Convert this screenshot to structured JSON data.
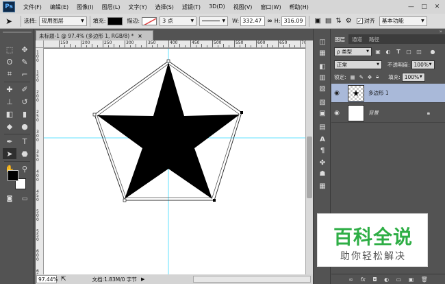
{
  "app": {
    "logo": "Ps"
  },
  "menu": [
    "文件(F)",
    "编辑(E)",
    "图像(I)",
    "图层(L)",
    "文字(Y)",
    "选择(S)",
    "滤镜(T)",
    "3D(D)",
    "视图(V)",
    "窗口(W)",
    "帮助(H)"
  ],
  "window_controls": {
    "minimize": "—",
    "restore": "□",
    "close": "✕"
  },
  "options": {
    "select_label": "选择:",
    "select_value": "现用图层",
    "fill_label": "填充:",
    "stroke_label": "描边:",
    "stroke_size": "3 点",
    "w_label": "W:",
    "w_value": "332.47",
    "link_icon": "link-icon",
    "h_label": "H:",
    "h_value": "316.09",
    "align_label": "对齐",
    "workspace": "基本功能",
    "fill_color": "#000000",
    "stroke_color": "#e04040"
  },
  "document": {
    "tab_title": "未标题-1 @ 97.4% (多边形 1, RGB/8) *",
    "close": "×",
    "ruler_h": [
      "150",
      "200",
      "250",
      "300",
      "350",
      "400",
      "450",
      "500",
      "550",
      "600",
      "650",
      "700"
    ],
    "ruler_v": [
      "1 0 0",
      "1 5 0",
      "2 0 0",
      "2 5 0",
      "3 0 0",
      "3 5 0",
      "4 0 0",
      "4 5 0",
      "5 0 0",
      "5 5 0",
      "6 0 0",
      "6 5 0"
    ],
    "shape": "star",
    "guide_color": "#5fe0ff"
  },
  "status": {
    "zoom": "97.44%",
    "doc_info": "文档:1.83M/0 字节",
    "arrow": "▶"
  },
  "layers_panel": {
    "tabs": [
      "图层",
      "通道",
      "路径"
    ],
    "filter_label": "ρ 类型",
    "blend_mode": "正常",
    "opacity_label": "不透明度:",
    "opacity_value": "100%",
    "lock_label": "锁定:",
    "fill_label": "填充:",
    "fill_value": "100%",
    "layers": [
      {
        "name": "多边形 1",
        "selected": true
      },
      {
        "name": "背景",
        "selected": false,
        "locked": true
      }
    ],
    "footer_icons": [
      "link-icon",
      "fx-icon",
      "mask-icon",
      "adjustment-icon",
      "group-icon",
      "new-layer-icon",
      "trash-icon"
    ]
  },
  "watermark": {
    "title": "百科全说",
    "subtitle": "助你轻松解决"
  }
}
